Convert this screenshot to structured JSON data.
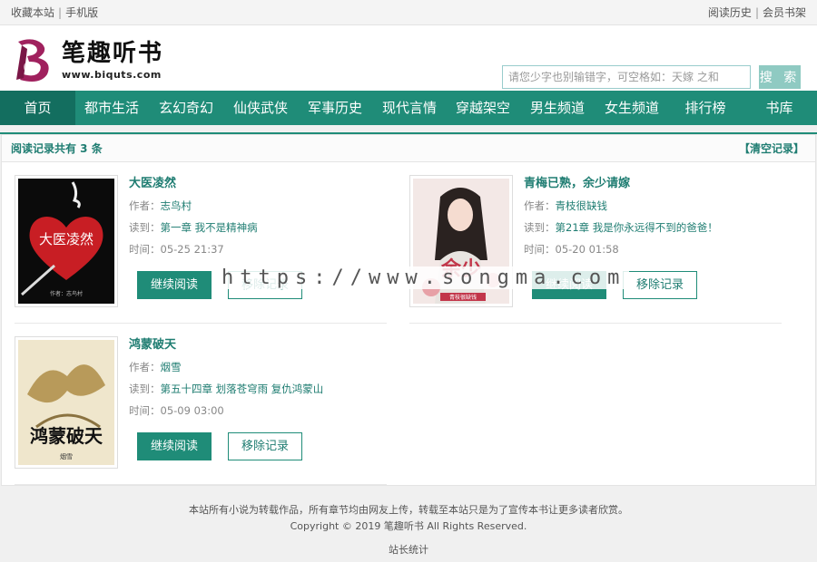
{
  "topbar": {
    "left": [
      "收藏本站",
      "手机版"
    ],
    "right": [
      "阅读历史",
      "会员书架"
    ]
  },
  "logo": {
    "name": "笔趣听书",
    "url": "www.biquts.com"
  },
  "search": {
    "placeholder": "请您少字也别输错字，可空格如：天嫁 之和",
    "button": "搜 索"
  },
  "nav": [
    "首页",
    "都市生活",
    "玄幻奇幻",
    "仙侠武侠",
    "军事历史",
    "现代言情",
    "穿越架空",
    "男生频道",
    "女生频道",
    "排行榜",
    "书库"
  ],
  "history": {
    "title": "阅读记录共有 3 条",
    "clear": "【清空记录】"
  },
  "labels": {
    "author": "作者：",
    "read": "读到：",
    "time": "时间：",
    "continue": "继续阅读",
    "remove": "移除记录"
  },
  "books": [
    {
      "title": "大医凌然",
      "author": "志鸟村",
      "chapter": "第一章 我不是精神病",
      "time": "05-25 21:37",
      "cover_text": "大医凌然",
      "cover_sub": "作者：志鸟村"
    },
    {
      "title": "青梅已熟，余少请嫁",
      "author": "青枝很缺钱",
      "chapter": "第21章 我是你永远得不到的爸爸！",
      "time": "05-20 01:58",
      "cover_text": "余少",
      "cover_sub": "青枝很缺钱"
    },
    {
      "title": "鸿蒙破天",
      "author": "烟雪",
      "chapter": "第五十四章 划落苍穹雨 复仇鸿蒙山",
      "time": "05-09 03:00",
      "cover_text": "鸿蒙破天",
      "cover_sub": "烟雪"
    }
  ],
  "footer": {
    "line1": "本站所有小说为转载作品，所有章节均由网友上传，转载至本站只是为了宣传本书让更多读者欣赏。",
    "line2": "Copyright © 2019 笔趣听书 All Rights Reserved.",
    "line3": "站长统计"
  },
  "watermark": "https://www.songma.com",
  "colors": {
    "accent": "#1f8c78",
    "accent_dark": "#136e5f"
  }
}
